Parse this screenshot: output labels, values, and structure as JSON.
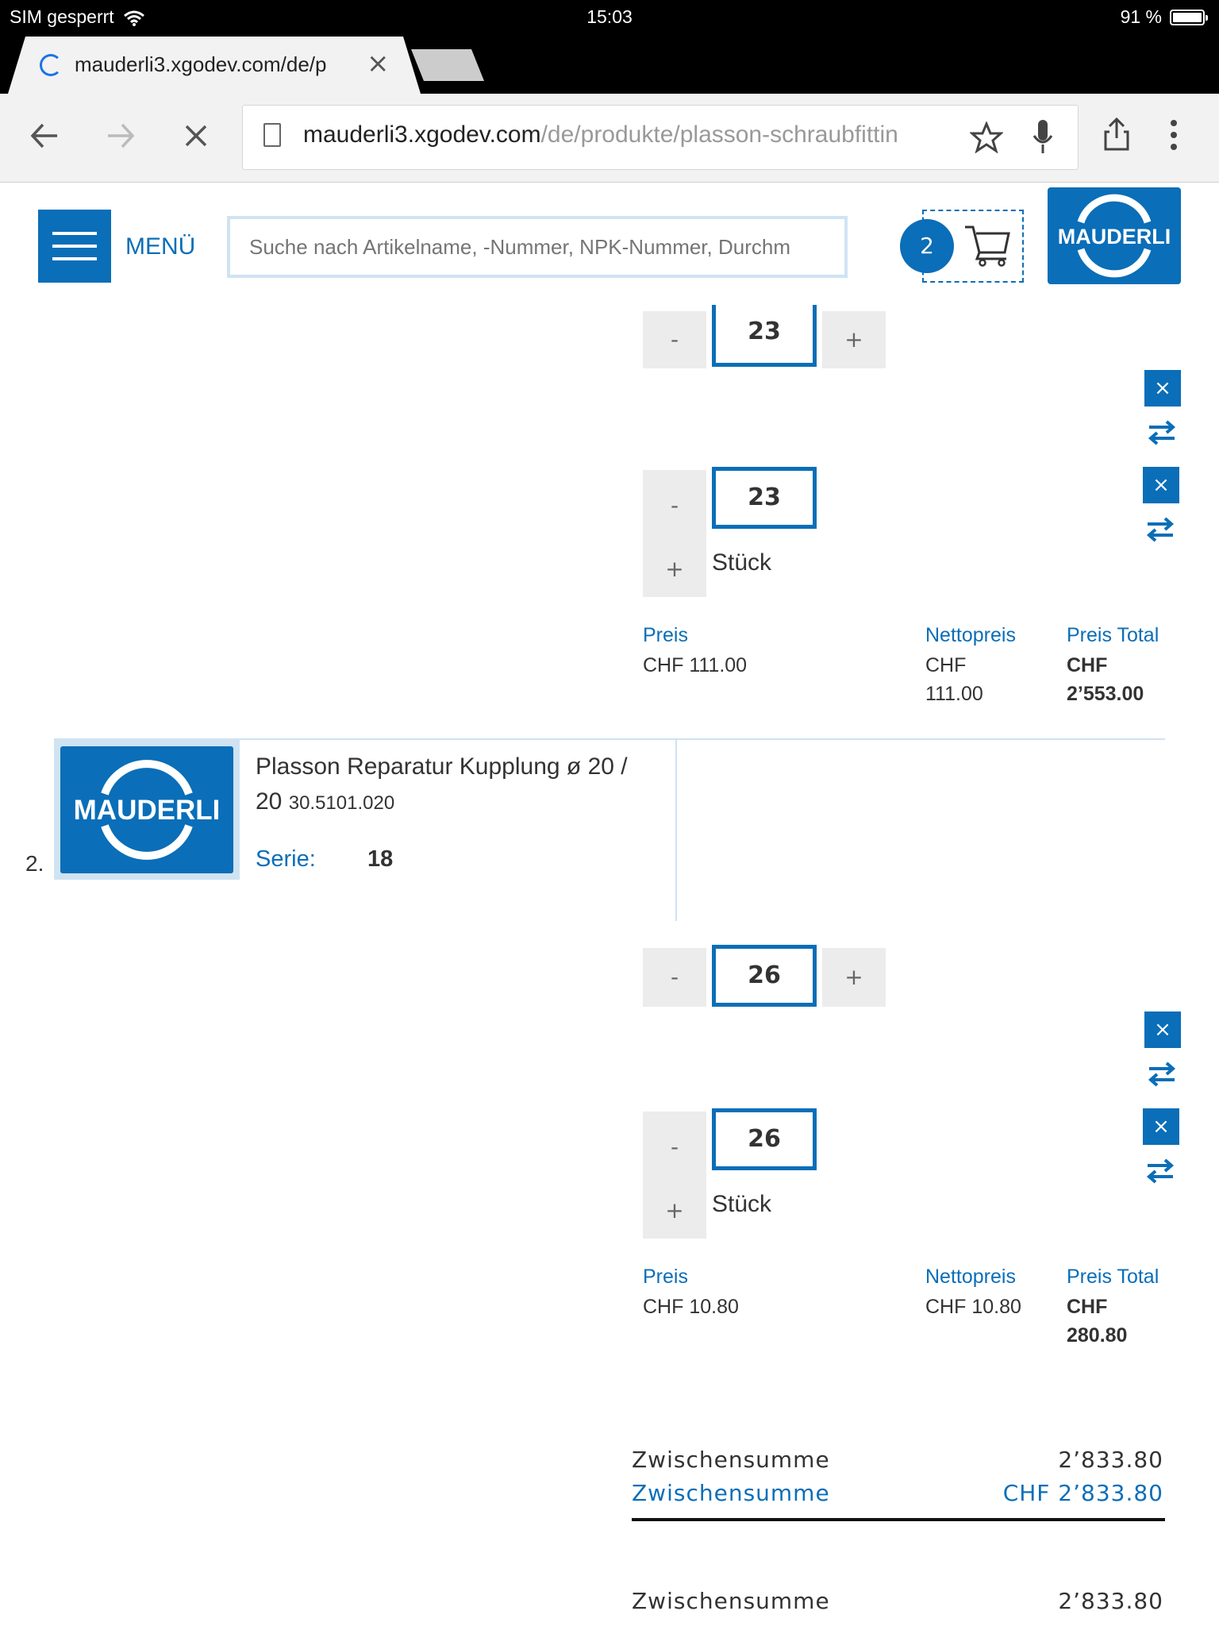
{
  "status_bar": {
    "carrier": "SIM gesperrt",
    "time": "15:03",
    "battery": "91 %"
  },
  "browser": {
    "tab_title": "mauderli3.xgodev.com/de/p",
    "url_host": "mauderli3.xgodev.com",
    "url_path": "/de/produkte/plasson-schraubfittin"
  },
  "header": {
    "menu_label": "MENÜ",
    "search_placeholder": "Suche nach Artikelname, -Nummer, NPK-Nummer, Durchm",
    "cart_count": "2",
    "logo_text": "MAUDERLI"
  },
  "items": [
    {
      "qty_top": "23",
      "qty": "23",
      "unit": "Stück",
      "price_label": "Preis",
      "price": "CHF 111.00",
      "net_label": "Nettopreis",
      "net_line1": "CHF",
      "net_line2": "111.00",
      "total_label": "Preis Total",
      "total_line1": "CHF",
      "total_line2": "2’553.00"
    },
    {
      "number": "2.",
      "title": "Plasson Reparatur Kupplung ø 20 / 20",
      "article_no": "30.5101.020",
      "serie_label": "Serie:",
      "serie_value": "18",
      "qty_top": "26",
      "qty": "26",
      "unit": "Stück",
      "price_label": "Preis",
      "price": "CHF 10.80",
      "net_label": "Nettopreis",
      "net_price": "CHF 10.80",
      "total_label": "Preis Total",
      "total_line1": "CHF",
      "total_line2": "280.80"
    }
  ],
  "summary": {
    "row1_label": "Zwischensumme",
    "row1_value": "2’833.80",
    "row2_label": "Zwischensumme",
    "row2_value": "CHF 2’833.80",
    "row3_label": "Zwischensumme",
    "row3_value": "2’833.80"
  },
  "icons": {
    "minus": "-",
    "plus": "+",
    "close": "×"
  },
  "colors": {
    "brand": "#0a6eb8",
    "light": "#cfe3f3"
  }
}
